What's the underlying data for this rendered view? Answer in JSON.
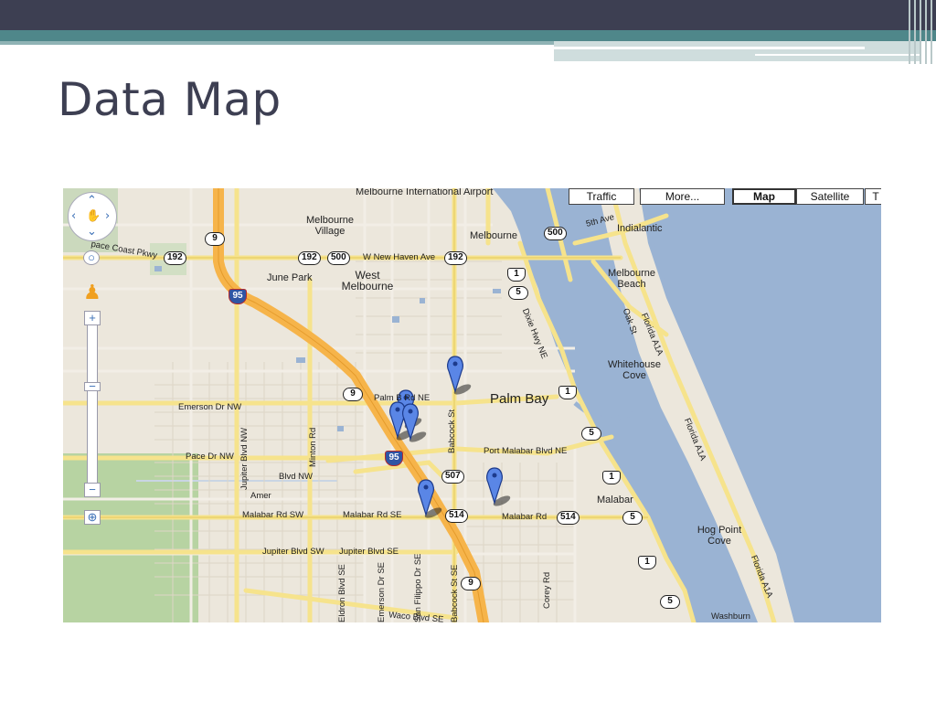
{
  "slide": {
    "title": "Data Map"
  },
  "map_controls": {
    "buttons": [
      {
        "label": "Traffic",
        "active": false
      },
      {
        "label": "More...",
        "active": false
      },
      {
        "label": "Map",
        "active": true
      },
      {
        "label": "Satellite",
        "active": false
      },
      {
        "label": "T",
        "active": false
      }
    ],
    "zoom_in": "+",
    "zoom_out": "−"
  },
  "places": {
    "melbourne_intl_airport": "Melbourne International Airport",
    "melbourne_village": "Melbourne Village",
    "melbourne": "Melbourne",
    "indialantic": "Indialantic",
    "june_park": "June Park",
    "west_melbourne": "West Melbourne",
    "melbourne_beach": "Melbourne Beach",
    "whitehouse_cove": "Whitehouse Cove",
    "palm_bay": "Palm Bay",
    "malabar": "Malabar",
    "hog_point_cove": "Hog Point Cove",
    "washburn": "Washburn",
    "amer": "Amer"
  },
  "roads": {
    "space_coast_pkwy": "pace Coast Pkwy",
    "w_new_haven": "W New Haven Ave",
    "fifth_ave": "5th Ave",
    "emerson_dr_nw": "Emerson Dr NW",
    "pace_dr_nw": "Pace Dr NW",
    "jupiter_blvd_nw": "Jupiter Blvd NW",
    "minton_rd": "Minton Rd",
    "palm_bay_rd": "Palm B   Rd NE",
    "babcock_st": "Babcock St",
    "dixie_hwy": "Dixie Hwy NE",
    "oak_st": "Oak St",
    "florida_a1a": "Florida A1A",
    "port_malabar": "Port Malabar Blvd NE",
    "blvd_nw": "Blvd NW",
    "malabar_rd_sw": "Malabar Rd SW",
    "malabar_rd_se": "Malabar Rd SE",
    "malabar_rd": "Malabar Rd",
    "jupiter_blvd_sw": "Jupiter Blvd SW",
    "jupiter_blvd_se": "Jupiter Blvd SE",
    "eldron_blvd": "Eldron Blvd SE",
    "emerson_dr_se": "Emerson Dr SE",
    "san_filippo": "San Filippo Dr SE",
    "corey_rd": "Corey Rd",
    "waco_blvd": "Waco Blvd SE",
    "babcock_st_s": "Babcock St SE"
  },
  "shields": {
    "r9a": "9",
    "r192a": "192",
    "r192b": "192",
    "r500a": "500",
    "r192c": "192",
    "r500b": "500",
    "r1a": "1",
    "r5a": "5",
    "i95a": "95",
    "r9b": "9",
    "r1b": "1",
    "r5b": "5",
    "i95b": "95",
    "r507": "507",
    "r1c": "1",
    "r514a": "514",
    "r514b": "514",
    "r5c": "5",
    "r1d": "1",
    "r9c": "9",
    "r5d": "5"
  },
  "colors": {
    "land": "#ece7dc",
    "water": "#9ab3d3",
    "park": "#b7d3a2",
    "interstate": "#f6b44a",
    "major_road": "#f6e38c",
    "marker": "#5a86e6",
    "slide_dark": "#3d3f52",
    "slide_teal": "#4f878a"
  }
}
